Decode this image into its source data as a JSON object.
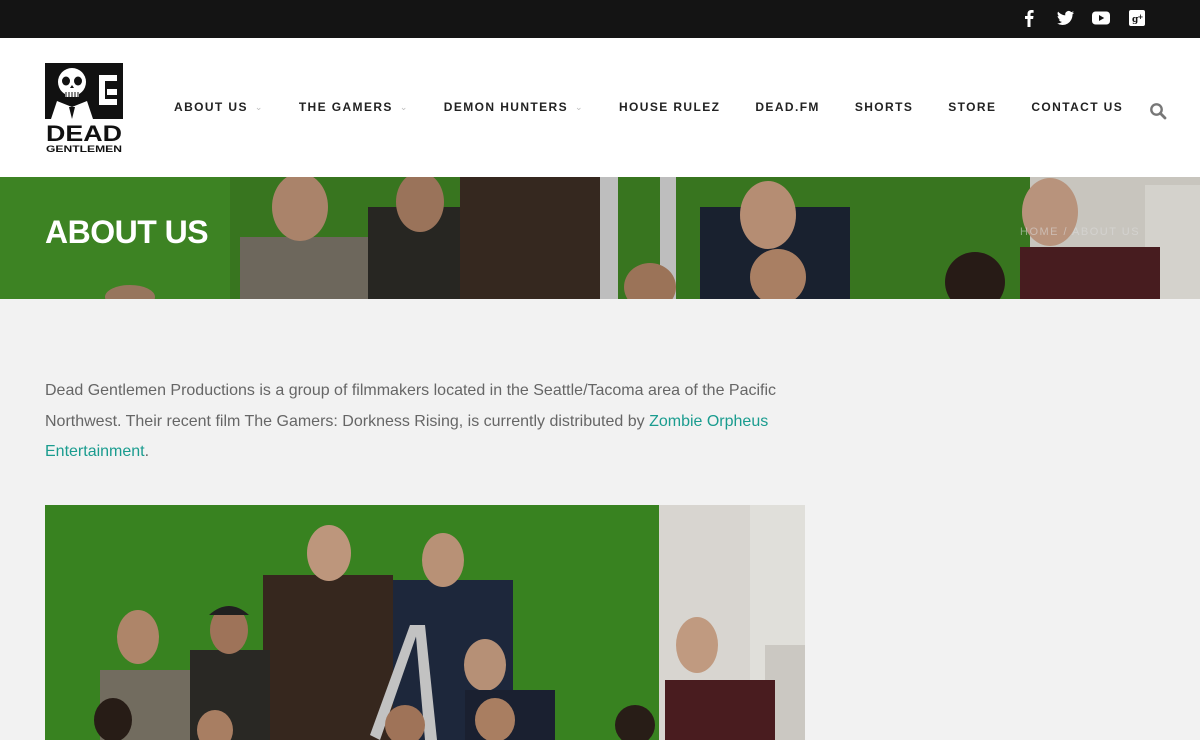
{
  "social": [
    {
      "icon": "facebook-icon"
    },
    {
      "icon": "twitter-icon"
    },
    {
      "icon": "youtube-icon"
    },
    {
      "icon": "google-plus-icon"
    }
  ],
  "logo": {
    "line1": "DEAD",
    "line2": "GENTLEMEN",
    "letter": "G"
  },
  "nav": [
    {
      "label": "ABOUT US",
      "dropdown": true
    },
    {
      "label": "THE GAMERS",
      "dropdown": true
    },
    {
      "label": "DEMON HUNTERS",
      "dropdown": true
    },
    {
      "label": "HOUSE RULEZ",
      "dropdown": false
    },
    {
      "label": "DEAD.FM",
      "dropdown": false
    },
    {
      "label": "SHORTS",
      "dropdown": false
    },
    {
      "label": "STORE",
      "dropdown": false
    },
    {
      "label": "CONTACT US",
      "dropdown": false
    }
  ],
  "banner": {
    "title": "ABOUT US",
    "breadcrumb": "HOME / ABOUT US"
  },
  "content": {
    "text_before": "Dead Gentlemen Productions is a group of filmmakers located in the Seattle/Tacoma area of the Pacific Northwest. Their recent film The Gamers: Dorkness Rising, is currently distributed by ",
    "link_text": "Zombie Orpheus Entertainment",
    "text_after": "."
  },
  "colors": {
    "accent": "#1a9c8f",
    "topbar": "#141414",
    "green_screen": "#3f8a26"
  }
}
